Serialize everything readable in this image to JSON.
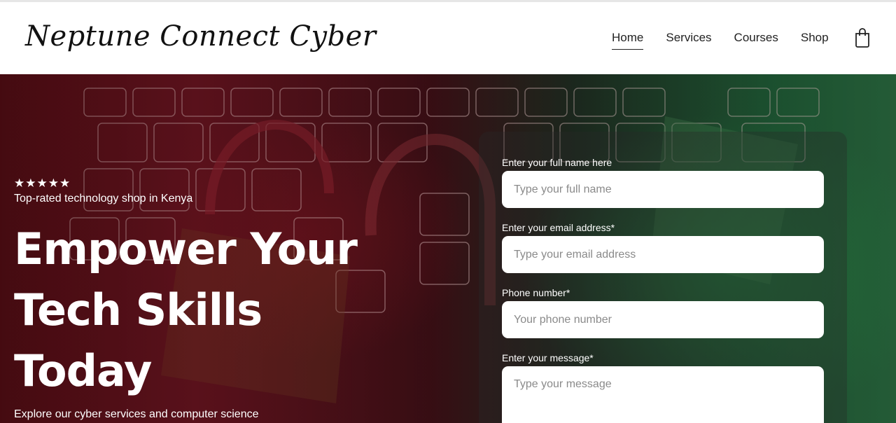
{
  "header": {
    "logo": "Neptune Connect Cyber",
    "nav": [
      "Home",
      "Services",
      "Courses",
      "Shop"
    ],
    "active_nav": "Home",
    "cart_icon": "shopping-bag-icon"
  },
  "hero": {
    "stars": "★★★★★",
    "tagline": "Top-rated technology shop in Kenya",
    "headline": "Empower Your Tech Skills Today",
    "subtext": "Explore our cyber services and computer science"
  },
  "form": {
    "name_label": "Enter your full name here",
    "name_placeholder": "Type your full name",
    "email_label": "Enter your email address*",
    "email_placeholder": "Type your email address",
    "phone_label": "Phone number*",
    "phone_placeholder": "Your phone number",
    "message_label": "Enter your message*",
    "message_placeholder": "Type your message"
  },
  "colors": {
    "hero_red": "#6a1420",
    "hero_green": "#2a6b40",
    "text_dark": "#222222"
  }
}
